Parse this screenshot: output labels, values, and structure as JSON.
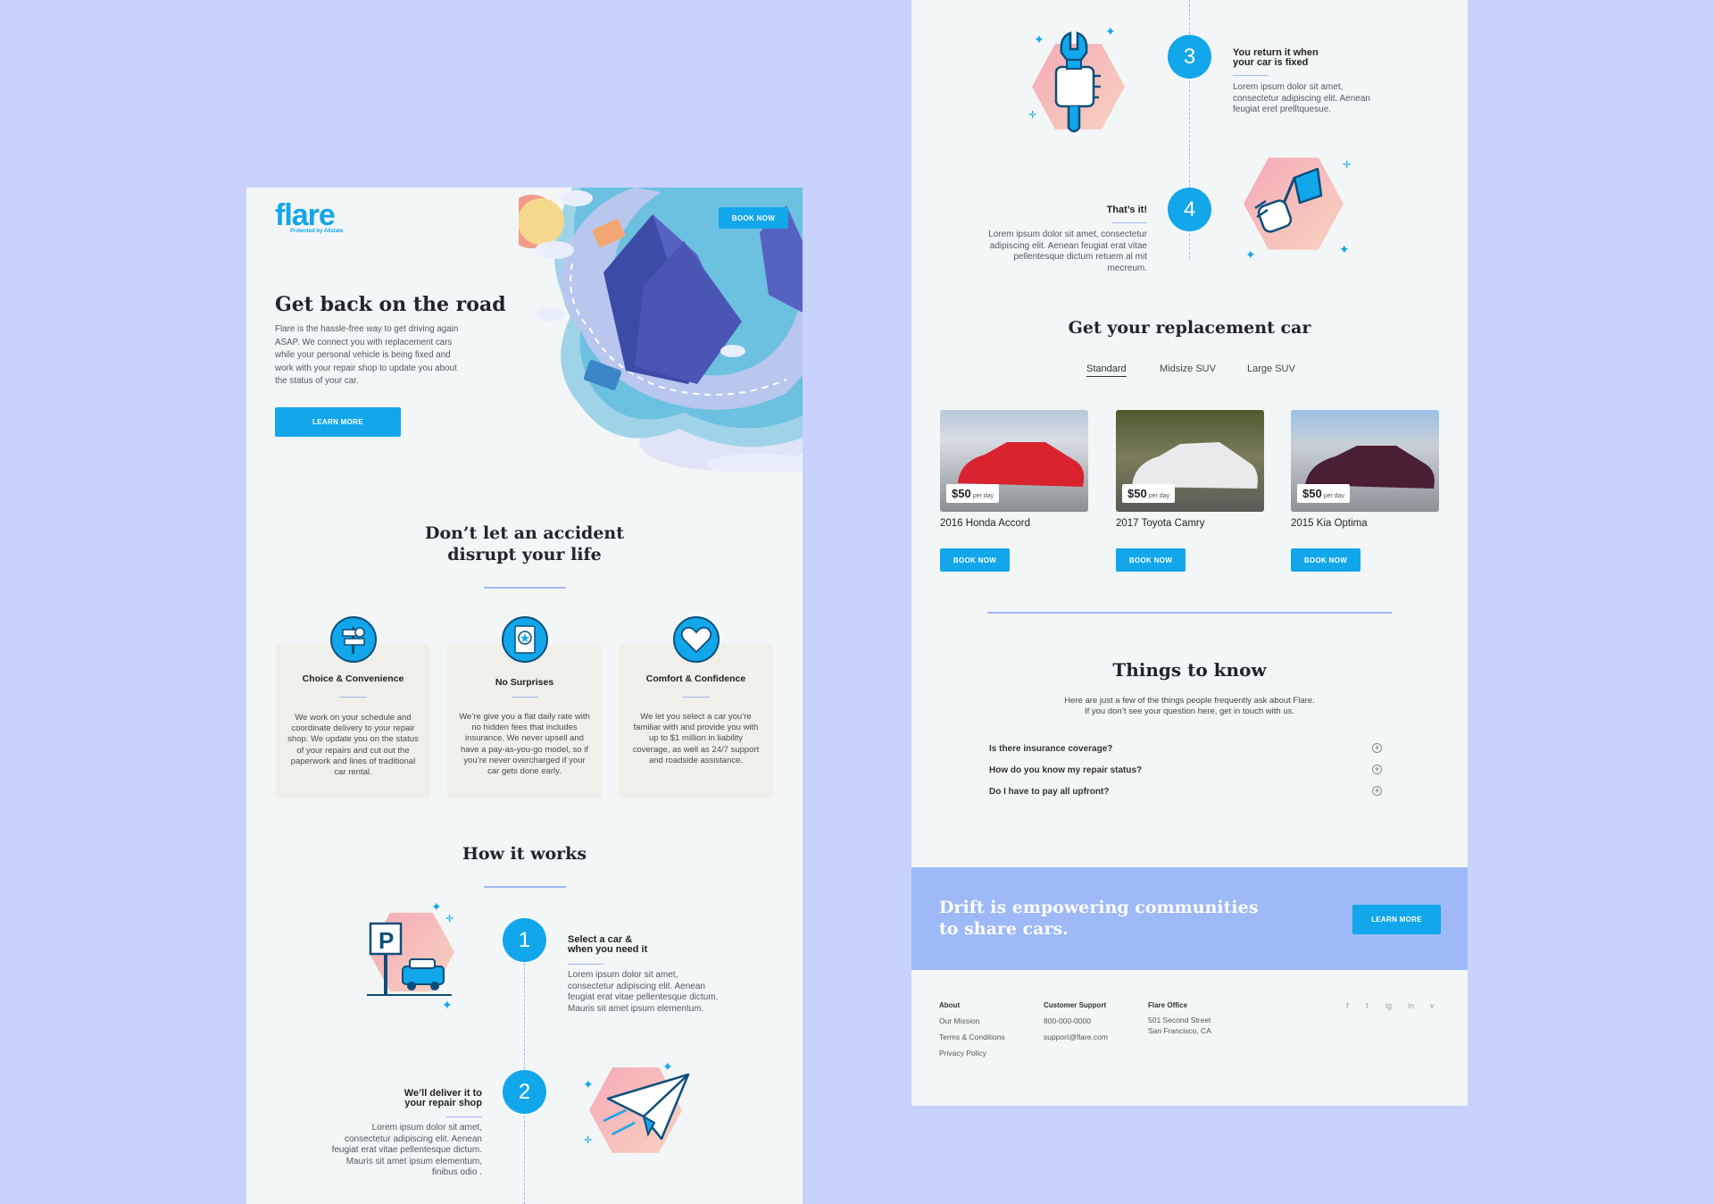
{
  "left": {
    "brand": {
      "logo": "flare",
      "tagline": "Protected by Allstate"
    },
    "header_cta": "BOOK NOW",
    "hero": {
      "title": "Get back on the road",
      "body": "Flare is the hassle-free way to get driving again ASAP. We connect you with replacement cars while your personal vehicle is being fixed and work with your repair shop to update you about the status of your car.",
      "cta": "LEARN MORE"
    },
    "benefits": {
      "title_line1": "Don’t let an accident",
      "title_line2": "disrupt your life",
      "cards": [
        {
          "icon": "signpost-icon",
          "title": "Choice & Convenience",
          "text": "We work on your schedule and coordinate delivery to your repair shop. We update you on the status of your repairs and cut out the paperwork and lines of traditional car rental."
        },
        {
          "icon": "badge-icon",
          "title": "No Surprises",
          "text": "We’re give you a flat daily rate with no hidden fees that includes insurance. We never upsell and have a pay-as-you-go model, so if you’re never overcharged if your car gets done early."
        },
        {
          "icon": "heart-icon",
          "title": "Comfort & Confidence",
          "text": "We let you select a car you’re familiar with and provide you with up to $1 million in liability coverage, as well as 24/7 support and roadside assistance."
        }
      ]
    },
    "how": {
      "title": "How it works",
      "steps": [
        {
          "num": "1",
          "title_line1": "Select a car &",
          "title_line2": "when you need it",
          "text": "Lorem ipsum dolor sit amet, consectetur adipiscing elit. Aenean feugiat erat vitae pellentesque dictum. Mauris sit amet ipsum elementum."
        },
        {
          "num": "2",
          "title_line1": "We’ll deliver it to",
          "title_line2": "your repair shop",
          "text": "Lorem ipsum dolor sit amet, consectetur adipiscing elit. Aenean feugiat erat vitae pellentesque dictum. Mauris sit amet ipsum elementum, finibus odio ."
        }
      ]
    }
  },
  "right": {
    "steps": [
      {
        "num": "3",
        "title_line1": "You return it when",
        "title_line2": "your car is fixed",
        "text": "Lorem ipsum dolor sit amet, consectetur adipiscing elit. Aenean feugiat eret prelltquesue."
      },
      {
        "num": "4",
        "title_line1": "That’s it!",
        "title_line2": "",
        "text": "Lorem ipsum dolor sit amet, consectetur adipiscing elit. Aenean feugiat erat vitae pellentesque dictum retuem al mit mecreum."
      }
    ],
    "cars": {
      "title": "Get your replacement car",
      "tabs": [
        "Standard",
        "Midsize SUV",
        "Large SUV"
      ],
      "items": [
        {
          "name": "2016 Honda Accord",
          "price": "$50",
          "unit": "per day",
          "cta": "BOOK NOW",
          "color": "#d8232e"
        },
        {
          "name": "2017 Toyota Camry",
          "price": "$50",
          "unit": "per day",
          "cta": "BOOK NOW",
          "color": "#e9eaec"
        },
        {
          "name": "2015 Kia Optima",
          "price": "$50",
          "unit": "per day",
          "cta": "BOOK NOW",
          "color": "#4a1e33"
        }
      ]
    },
    "faq": {
      "title": "Things to know",
      "intro_line1": "Here are just a few of the things people frequently ask about Flare.",
      "intro_line2": "If you don’t see your question here, get in touch with us.",
      "questions": [
        "Is there insurance coverage?",
        "How do you know my repair status?",
        "Do I have to pay all upfront?"
      ]
    },
    "banner": {
      "line1": "Drift is empowering communities",
      "line2": "to share cars.",
      "cta": "LEARN MORE"
    },
    "footer": {
      "about": {
        "heading": "About",
        "links": [
          "Our Mission",
          "Terms & Conditions",
          "Privacy Policy"
        ]
      },
      "support": {
        "heading": "Customer Support",
        "phone": "800-000-0000",
        "email": "support@flare.com"
      },
      "office": {
        "heading": "Flare Office",
        "line1": "501 Second Street",
        "line2": "San Francisco, CA"
      },
      "social": [
        "f",
        "t",
        "ig",
        "in",
        "v"
      ]
    }
  },
  "colors": {
    "accent": "#12a6ea",
    "rule": "#9db8f2",
    "banner": "#9db9f8",
    "background": "#c8d2fc",
    "page": "#f3f6f7"
  }
}
